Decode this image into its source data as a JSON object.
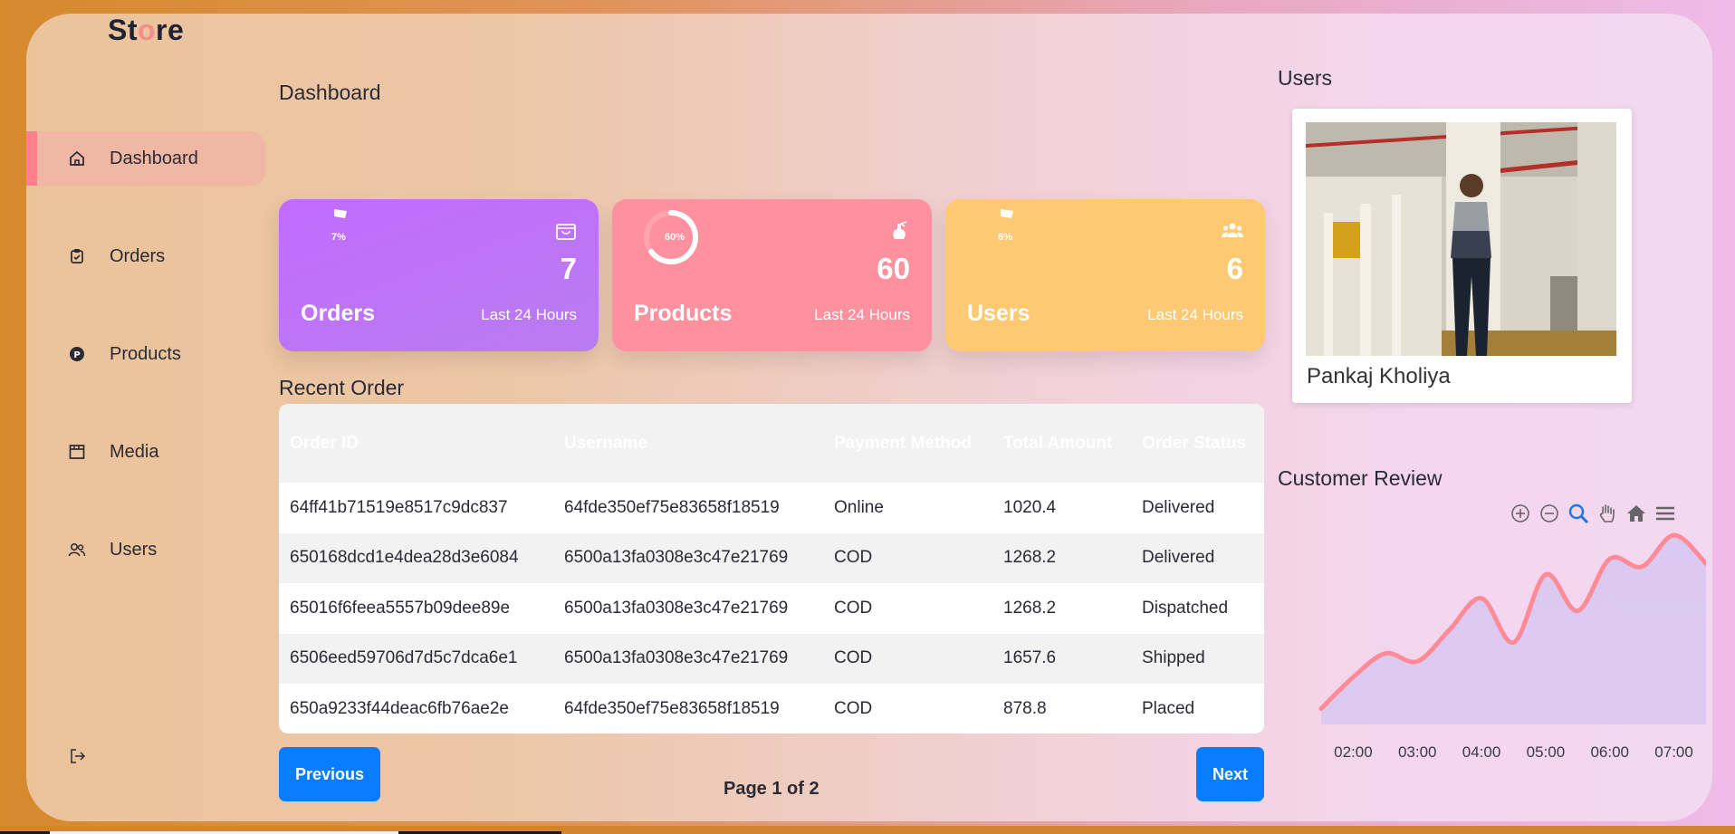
{
  "app": {
    "logo_prefix": "St",
    "logo_dot": "o",
    "logo_suffix": "re"
  },
  "sidebar": {
    "items": [
      {
        "label": "Dashboard",
        "icon": "home-icon",
        "active": true
      },
      {
        "label": "Orders",
        "icon": "clipboard-icon"
      },
      {
        "label": "Products",
        "icon": "product-p-icon"
      },
      {
        "label": "Media",
        "icon": "media-icon"
      },
      {
        "label": "Users",
        "icon": "users-icon"
      }
    ],
    "logout_icon": "logout-icon"
  },
  "page": {
    "title": "Dashboard"
  },
  "cards": [
    {
      "name": "Orders",
      "value": "7",
      "percent": "7%",
      "sub": "Last 24 Hours",
      "icon": "shopping-bag-icon",
      "color": "#c26bff"
    },
    {
      "name": "Products",
      "value": "60",
      "percent": "60%",
      "sub": "Last 24 Hours",
      "icon": "perfume-bottle-icon",
      "color": "#ff909e"
    },
    {
      "name": "Users",
      "value": "6",
      "percent": "6%",
      "sub": "Last 24 Hours",
      "icon": "users-group-icon",
      "color": "#ffc973"
    }
  ],
  "recent_orders": {
    "title": "Recent Order",
    "headers": [
      "Order ID",
      "Username",
      "Payment Method",
      "Total Amount",
      "Order Status"
    ],
    "rows": [
      [
        "64ff41b71519e8517c9dc837",
        "64fde350ef75e83658f18519",
        "Online",
        "1020.4",
        "Delivered"
      ],
      [
        "650168dcd1e4dea28d3e6084",
        "6500a13fa0308e3c47e21769",
        "COD",
        "1268.2",
        "Delivered"
      ],
      [
        "65016f6feea5557b09dee89e",
        "6500a13fa0308e3c47e21769",
        "COD",
        "1268.2",
        "Dispatched"
      ],
      [
        "6506eed59706d7d5c7dca6e1",
        "6500a13fa0308e3c47e21769",
        "COD",
        "1657.6",
        "Shipped"
      ],
      [
        "650a9233f44deac6fb76ae2e",
        "64fde350ef75e83658f18519",
        "COD",
        "878.8",
        "Placed"
      ]
    ]
  },
  "pagination": {
    "previous": "Previous",
    "next": "Next",
    "label": "Page 1 of 2"
  },
  "users_panel": {
    "title": "Users",
    "user_name": "Pankaj Kholiya"
  },
  "review": {
    "title": "Customer Review",
    "toolbar": [
      "zoom-in-icon",
      "zoom-out-icon",
      "magnifier-icon",
      "pan-hand-icon",
      "home-reset-icon",
      "menu-icon"
    ]
  },
  "chart_data": {
    "type": "area",
    "x": [
      "01:30",
      "02:00",
      "02:30",
      "03:00",
      "03:30",
      "04:00",
      "04:30",
      "05:00",
      "05:30",
      "06:00",
      "06:30",
      "07:00",
      "07:30"
    ],
    "y": [
      0.1,
      0.3,
      0.45,
      0.4,
      0.6,
      0.8,
      0.52,
      0.95,
      0.72,
      1.05,
      1.0,
      1.2,
      1.02
    ],
    "tick_labels": [
      "02:00",
      "03:00",
      "04:00",
      "05:00",
      "06:00",
      "07:00"
    ],
    "line_color": "#ff8a98",
    "fill_color": "#d9c8f2",
    "grid": false
  }
}
